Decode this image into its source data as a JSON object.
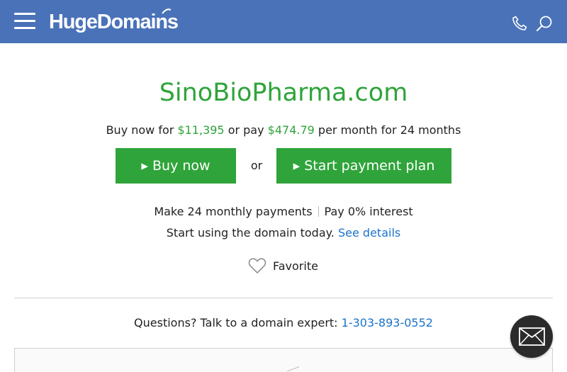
{
  "header": {
    "logo_text": "HugeDomains",
    "menu_icon": "hamburger-menu-icon",
    "phone_icon": "phone-icon",
    "search_icon": "search-icon",
    "background_color": "#4a72b8"
  },
  "domain": {
    "name": "SinoBioPharma.com",
    "color": "#2fa43a"
  },
  "pricing": {
    "buy_prefix": "Buy now for ",
    "buy_price": "$11,395",
    "pay_middle": " or pay ",
    "monthly_price": "$474.79",
    "pay_suffix": " per month for 24 months"
  },
  "buttons": {
    "buy_now": "▸ Buy now",
    "or": "or",
    "payment_plan": "▸ Start payment plan",
    "color": "#2fa43a"
  },
  "features": {
    "monthly": "Make 24 monthly payments",
    "interest": "Pay 0% interest",
    "start_text": "Start using the domain today. ",
    "details_link": "See details"
  },
  "favorite": {
    "label": "Favorite",
    "icon": "heart-outline-icon"
  },
  "contact": {
    "prompt": "Questions? Talk to a domain expert: ",
    "phone": "1-303-893-0552",
    "mail_icon": "envelope-icon"
  }
}
